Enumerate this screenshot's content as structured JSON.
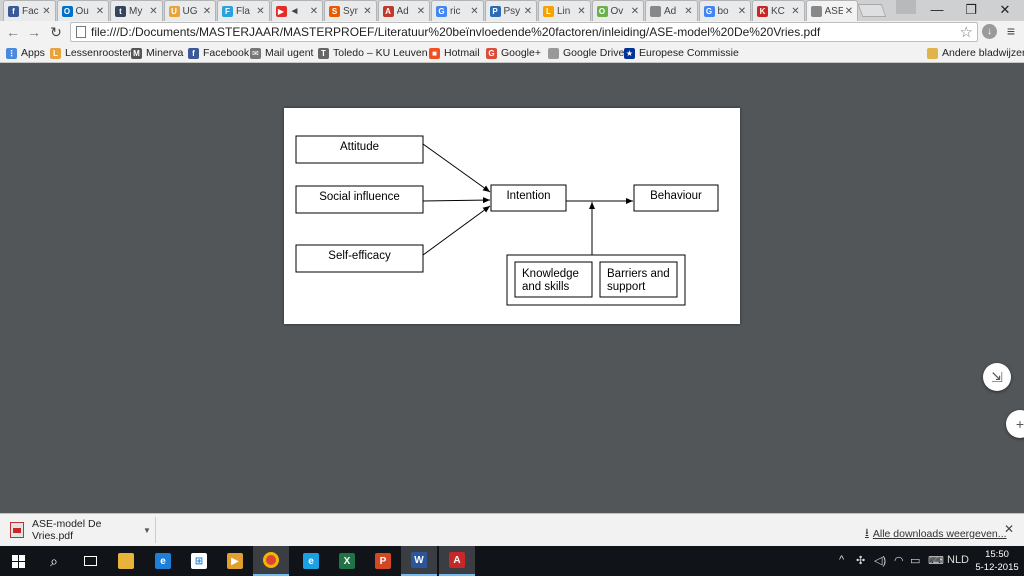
{
  "browser": {
    "tabs": [
      {
        "title": "Fac",
        "color": "#3b5998",
        "glyph": "f"
      },
      {
        "title": "Ou",
        "color": "#0072c6",
        "glyph": "O"
      },
      {
        "title": "My",
        "color": "#35465c",
        "glyph": "t"
      },
      {
        "title": "UG",
        "color": "#e8a33c",
        "glyph": "U"
      },
      {
        "title": "Fla",
        "color": "#29a3e0",
        "glyph": "F"
      },
      {
        "title": "◄",
        "color": "#e52d27",
        "glyph": "▶"
      },
      {
        "title": "Syr",
        "color": "#e65c00",
        "glyph": "S"
      },
      {
        "title": "Ad",
        "color": "#c0392b",
        "glyph": "A"
      },
      {
        "title": "ric",
        "color": "#4285f4",
        "glyph": "G"
      },
      {
        "title": "Psy",
        "color": "#2a6bb5",
        "glyph": "P"
      },
      {
        "title": "Lin",
        "color": "#f4a300",
        "glyph": "L"
      },
      {
        "title": "Ov",
        "color": "#6ab04c",
        "glyph": "O"
      },
      {
        "title": "Ad",
        "color": "#888888",
        "glyph": ""
      },
      {
        "title": "bo",
        "color": "#4285f4",
        "glyph": "G"
      },
      {
        "title": "KC",
        "color": "#c62828",
        "glyph": "K"
      },
      {
        "title": "ASE",
        "color": "#888888",
        "glyph": ""
      }
    ],
    "active_tab_index": 15,
    "url": "file:///D:/Documents/MASTERJAAR/MASTERPROEF/Literatuur%20beïnvloedende%20factoren/inleiding/ASE-model%20De%20Vries.pdf",
    "window_controls": {
      "minimize": "—",
      "restore": "❐",
      "close": "✕"
    },
    "nav": {
      "back": "←",
      "forward": "→",
      "reload": "↻"
    },
    "bookmarks": [
      {
        "label": "Apps",
        "color": "#4a89dc",
        "glyph": "⋮"
      },
      {
        "label": "Lessenrooster",
        "color": "#e8a33c",
        "glyph": "L"
      },
      {
        "label": "Minerva",
        "color": "#555555",
        "glyph": "M"
      },
      {
        "label": "Facebook",
        "color": "#3b5998",
        "glyph": "f"
      },
      {
        "label": "Mail ugent",
        "color": "#777777",
        "glyph": "✉"
      },
      {
        "label": "Toledo – KU Leuven ...",
        "color": "#666666",
        "glyph": "T"
      },
      {
        "label": "Hotmail",
        "color": "#f25022",
        "glyph": "■"
      },
      {
        "label": "Google+",
        "color": "#dd4b39",
        "glyph": "G"
      },
      {
        "label": "Google Drive",
        "color": "#999999",
        "glyph": ""
      },
      {
        "label": "Europese Commissie",
        "color": "#003399",
        "glyph": "★"
      },
      {
        "label": "Andere bladwijzers",
        "color": "#e0b44a",
        "glyph": ""
      }
    ]
  },
  "diagram": {
    "nodes": {
      "attitude": "Attitude",
      "social_influence": "Social influence",
      "self_efficacy": "Self-efficacy",
      "intention": "Intention",
      "behaviour": "Behaviour",
      "knowledge_line1": "Knowledge",
      "knowledge_line2": "and skills",
      "barriers_line1": "Barriers and",
      "barriers_line2": "support"
    }
  },
  "pdf_controls": {
    "fit": "⇲",
    "zoom_in": "+"
  },
  "downloads": {
    "filename": "ASE-model De Vries.pdf",
    "show_all": "Alle downloads weergeven...",
    "close": "✕"
  },
  "taskbar": {
    "language": "NLD",
    "time": "15:50",
    "date": "5-12-2015"
  }
}
